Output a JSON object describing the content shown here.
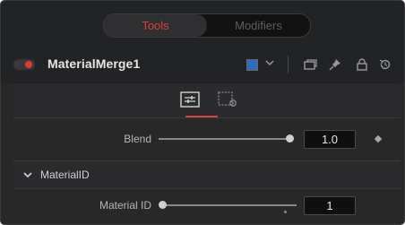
{
  "tabs": {
    "tools": "Tools",
    "modifiers": "Modifiers"
  },
  "header": {
    "title": "MaterialMerge1",
    "color_swatch": "#2a6fbf",
    "accent": "#e0403a"
  },
  "controls": {
    "blend": {
      "label": "Blend",
      "value": "1.0",
      "fraction": 1.0
    },
    "section": {
      "label": "MaterialID"
    },
    "material_id": {
      "label": "Material ID",
      "value": "1",
      "fraction": 0.0
    }
  },
  "icons": {
    "subtab_controls": "sliders-icon",
    "subtab_settings": "gear-panel-icon",
    "header": [
      "dropdown-chevron-icon",
      "window-icon",
      "pin-icon",
      "lock-icon",
      "reset-icon"
    ]
  }
}
